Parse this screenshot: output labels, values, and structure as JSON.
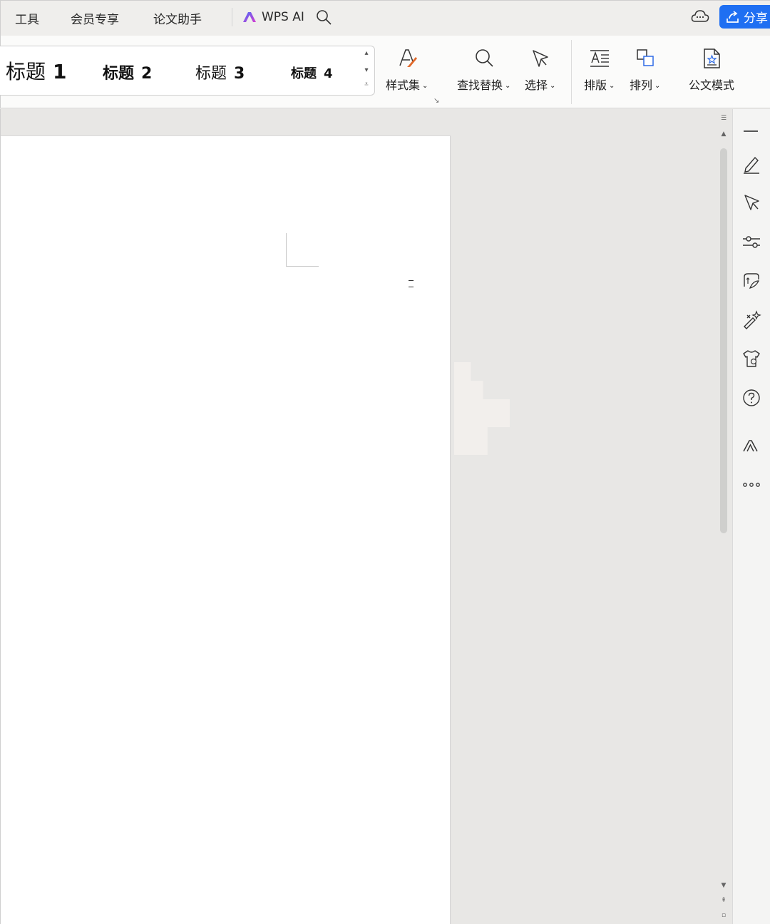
{
  "menubar": {
    "items": [
      "工具",
      "会员专享",
      "论文助手"
    ],
    "wps_ai_label": "WPS AI",
    "share_label": "分享"
  },
  "ribbon": {
    "styles": [
      {
        "name": "标题",
        "level": "1"
      },
      {
        "name": "标题",
        "level": "2"
      },
      {
        "name": "标题",
        "level": "3"
      },
      {
        "name": "标题",
        "level": "4"
      }
    ],
    "buttons": {
      "style_set": "样式集",
      "find_replace": "查找替换",
      "select": "选择",
      "layout": "排版",
      "arrange": "排列",
      "official_doc_mode": "公文模式"
    }
  },
  "colors": {
    "accent": "#1f6ff2",
    "ribbon_bg": "#fbfbfa",
    "workspace_bg": "#e8e7e5",
    "wps_ai_gradient": [
      "#4a6cf7",
      "#d63bd1"
    ]
  },
  "sidebar": {
    "icons": [
      "pen-icon",
      "select-pointer-icon",
      "adjust-sliders-icon",
      "style-brush-icon",
      "magic-wand-icon",
      "shirt-theme-icon",
      "help-icon",
      "wps-ai-icon",
      "more-icon"
    ]
  }
}
